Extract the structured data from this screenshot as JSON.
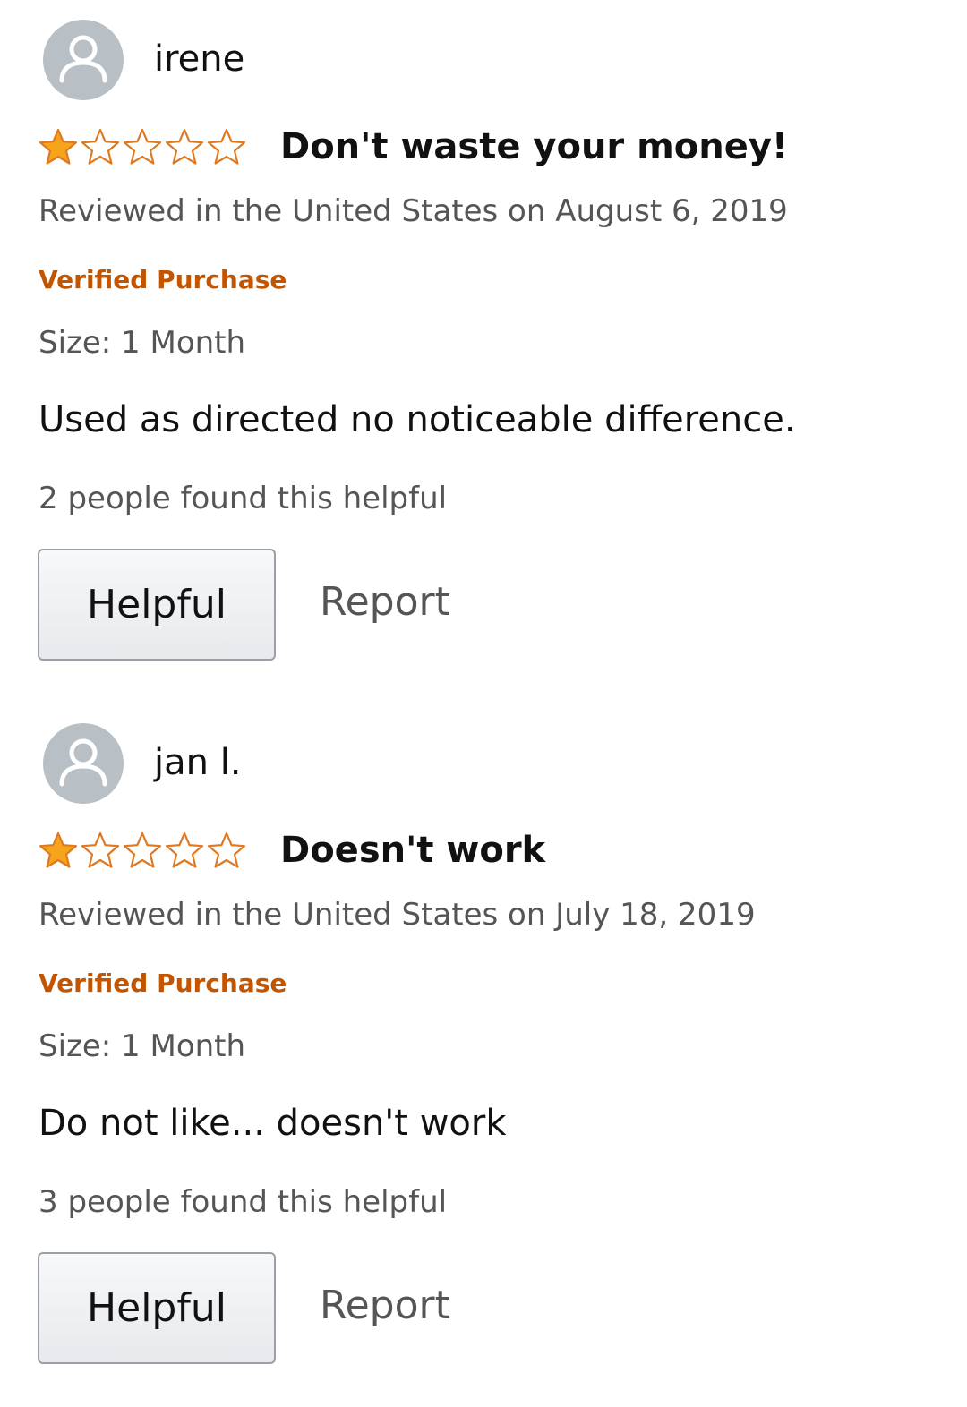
{
  "colors": {
    "star_filled": "#f7a41d",
    "star_outline": "#de7921",
    "verified": "#c45500",
    "meta_text": "#555555",
    "avatar_bg": "#b8c0c6"
  },
  "reviews": [
    {
      "username": "irene",
      "rating": 1,
      "rating_max": 5,
      "title": "Don't waste your money!",
      "meta": "Reviewed in the United States on August 6, 2019",
      "verified": "Verified Purchase",
      "size": "Size: 1 Month",
      "body": "Used as directed no noticeable difference.",
      "helpful_count": "2 people found this helpful",
      "helpful_label": "Helpful",
      "report_label": "Report",
      "avatar_icon": "default-user-avatar-icon"
    },
    {
      "username": "jan l.",
      "rating": 1,
      "rating_max": 5,
      "title": "Doesn't work",
      "meta": "Reviewed in the United States on July 18, 2019",
      "verified": "Verified Purchase",
      "size": "Size: 1 Month",
      "body": "Do not like... doesn't work",
      "helpful_count": "3 people found this helpful",
      "helpful_label": "Helpful",
      "report_label": "Report",
      "avatar_icon": "default-user-avatar-icon"
    }
  ]
}
